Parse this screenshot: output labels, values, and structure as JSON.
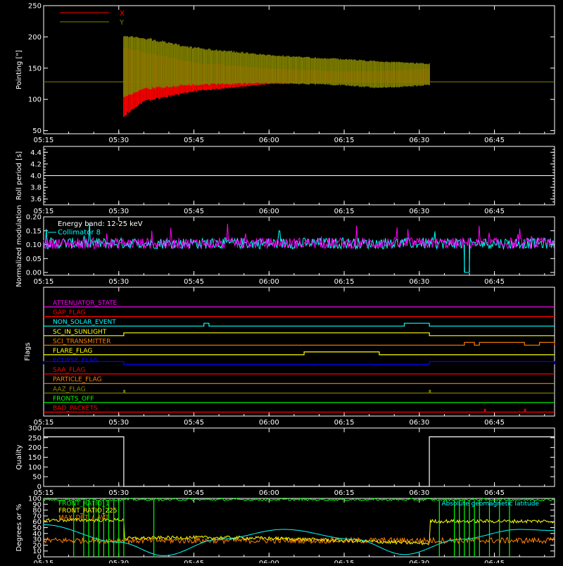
{
  "colors": {
    "background": "#000000",
    "axis": "#ffffff",
    "red": "#ff0000",
    "olive": "#808000",
    "white": "#ffffff",
    "cyan": "#00ffff",
    "magenta": "#ff00ff",
    "green": "#00ff00",
    "yellow": "#ffff00",
    "orange": "#ff8000",
    "blue": "#0000ff",
    "olive_dark": "#8a8a00"
  },
  "time_axis": {
    "ticks": [
      "05:15",
      "05:30",
      "05:45",
      "06:00",
      "06:15",
      "06:30",
      "06:45"
    ]
  },
  "chart_data": [
    {
      "id": "pointing",
      "type": "line",
      "ylabel": "Pointing [\"]",
      "ylim": [
        45,
        250
      ],
      "yticks": [
        50,
        100,
        150,
        200,
        250
      ],
      "legend_position": "top-left",
      "series": [
        {
          "name": "X",
          "color": "red",
          "hidden_before": "05:31",
          "envelope": [
            {
              "t": "05:31",
              "lo": 70,
              "hi": 185
            },
            {
              "t": "05:35",
              "lo": 95,
              "hi": 178
            },
            {
              "t": "05:45",
              "lo": 112,
              "hi": 160
            },
            {
              "t": "06:00",
              "lo": 124,
              "hi": 150
            },
            {
              "t": "06:15",
              "lo": 127,
              "hi": 145
            },
            {
              "t": "06:27",
              "lo": 126,
              "hi": 147
            },
            {
              "t": "06:32",
              "lo": 124,
              "hi": 150
            }
          ]
        },
        {
          "name": "Y",
          "color": "olive",
          "baseline": 128,
          "envelope": [
            {
              "t": "05:31",
              "lo": 100,
              "hi": 205
            },
            {
              "t": "05:35",
              "lo": 115,
              "hi": 200
            },
            {
              "t": "05:45",
              "lo": 122,
              "hi": 184
            },
            {
              "t": "06:00",
              "lo": 125,
              "hi": 172
            },
            {
              "t": "06:15",
              "lo": 122,
              "hi": 165
            },
            {
              "t": "06:22",
              "lo": 117,
              "hi": 162
            },
            {
              "t": "06:32",
              "lo": 122,
              "hi": 158
            }
          ]
        }
      ]
    },
    {
      "id": "roll",
      "type": "line",
      "ylabel": "Roll period [s]",
      "ylim": [
        3.5,
        4.5
      ],
      "yticks": [
        3.6,
        3.8,
        4.0,
        4.2,
        4.4
      ],
      "series": [
        {
          "name": "",
          "color": "white",
          "points": [
            [
              "05:15",
              4.0
            ],
            [
              "06:57",
              4.0
            ]
          ]
        }
      ]
    },
    {
      "id": "modulation",
      "type": "line",
      "ylabel": "Normalized modulation",
      "ylim": [
        -0.01,
        0.2
      ],
      "yticks": [
        0.0,
        0.05,
        0.1,
        0.15,
        0.2
      ],
      "legend_position": "top-left",
      "annotations": [
        "Energy band: 12-25 keV"
      ],
      "series": [
        {
          "name": "Collimator 8",
          "color": "cyan",
          "mean": 0.105,
          "noise": 0.02,
          "dropouts": [
            [
              "06:39",
              0.0
            ],
            [
              "06:40",
              0.0
            ]
          ]
        },
        {
          "name": "",
          "color": "magenta",
          "mean": 0.105,
          "noise": 0.02
        }
      ]
    },
    {
      "id": "flags",
      "type": "line",
      "ylabel": "Flags",
      "flags": [
        {
          "label": "ATTENUATOR_STATE",
          "color": "magenta",
          "high": []
        },
        {
          "label": "GAP_FLAG",
          "color": "red",
          "high": []
        },
        {
          "label": "NON_SOLAR_EVENT",
          "color": "cyan",
          "high": [
            [
              "05:47",
              "05:48"
            ],
            [
              "06:27",
              "06:32"
            ]
          ]
        },
        {
          "label": "SC_IN_SUNLIGHT",
          "color": "yellow",
          "high": [
            [
              "05:31",
              "06:32"
            ]
          ]
        },
        {
          "label": "SCI_TRANSMITTER",
          "color": "orange",
          "high": [
            [
              "06:39",
              "06:41"
            ],
            [
              "06:42",
              "06:51"
            ],
            [
              "06:54",
              "06:57"
            ]
          ]
        },
        {
          "label": "FLARE_FLAG",
          "color": "yellow",
          "high": [
            [
              "06:07",
              "06:22"
            ]
          ]
        },
        {
          "label": "ECLIPSE_FLAG",
          "color": "blue",
          "high": [
            [
              "05:15",
              "05:31"
            ],
            [
              "06:32",
              "06:57"
            ]
          ]
        },
        {
          "label": "SAA_FLAG",
          "color": "red",
          "high": []
        },
        {
          "label": "PARTICLE_FLAG",
          "color": "orange",
          "high": []
        },
        {
          "label": "AAZ_FLAG",
          "color": "olive_dark",
          "high": [
            [
              "05:31",
              "05:31"
            ],
            [
              "06:32",
              "06:32"
            ]
          ]
        },
        {
          "label": "FRONTS_OFF",
          "color": "green",
          "high": []
        },
        {
          "label": "BAD_PACKETS",
          "color": "red",
          "high": [
            [
              "06:43",
              "06:43"
            ],
            [
              "06:51",
              "06:51"
            ]
          ]
        }
      ]
    },
    {
      "id": "quality",
      "type": "line",
      "ylabel": "Quality",
      "ylim": [
        0,
        300
      ],
      "yticks": [
        0,
        50,
        100,
        150,
        200,
        250,
        300
      ],
      "series": [
        {
          "name": "",
          "color": "white",
          "points": [
            [
              "05:15",
              255
            ],
            [
              "05:31",
              255
            ],
            [
              "05:31",
              0
            ],
            [
              "06:32",
              0
            ],
            [
              "06:32",
              255
            ],
            [
              "06:57",
              255
            ]
          ]
        }
      ]
    },
    {
      "id": "rates",
      "type": "line",
      "ylabel": "Degrees or %",
      "ylim": [
        0,
        100
      ],
      "yticks": [
        0,
        10,
        20,
        30,
        40,
        50,
        60,
        70,
        80,
        90,
        100
      ],
      "legend_position": "top-left",
      "series": [
        {
          "name": "FRONT_RATIO_1",
          "color": "green",
          "mean": 98
        },
        {
          "name": "FRONT_RATIO_225",
          "color": "yellow",
          "mean": 55
        },
        {
          "name": "MAX_DET_/_AVT",
          "color": "orange",
          "mean": 28
        },
        {
          "name": "Absolute geomagnetic latitude",
          "color": "cyan",
          "points": [
            [
              "05:15",
              55
            ],
            [
              "05:30",
              25
            ],
            [
              "05:39",
              2
            ],
            [
              "05:50",
              30
            ],
            [
              "06:03",
              47
            ],
            [
              "06:17",
              30
            ],
            [
              "06:27",
              4
            ],
            [
              "06:38",
              30
            ],
            [
              "06:50",
              47
            ],
            [
              "06:57",
              45
            ]
          ]
        }
      ]
    }
  ]
}
